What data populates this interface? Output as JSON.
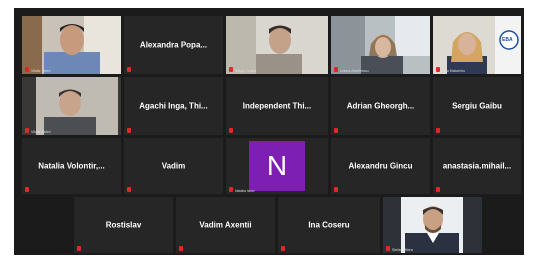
{
  "tiles": {
    "t1": {
      "caption": "Vitalie Tarlev"
    },
    "t2": {
      "name": "Alexandra Popa..."
    },
    "t3": {
      "caption": "Sergiu Dudka"
    },
    "t4": {
      "caption": "Iuliana Zamfirescu"
    },
    "t5": {
      "caption": "Irina Matcenko"
    },
    "t6": {
      "caption": "Vitalie Tarlev"
    },
    "t7": {
      "name": "Agachi Inga, Thi..."
    },
    "t8": {
      "name": "Independent Thi..."
    },
    "t9": {
      "name": "Adrian Gheorgh..."
    },
    "t10": {
      "name": "Sergiu Gaibu"
    },
    "t11": {
      "name": "Natalia Volontir,..."
    },
    "t12": {
      "name": "Vadim"
    },
    "t13": {
      "letter": "N",
      "caption": "Natalia Iarov"
    },
    "t14": {
      "name": "Alexandru Gincu"
    },
    "t15": {
      "name": "anastasia.mihail..."
    },
    "t16": {
      "name": "Rostislav"
    },
    "t17": {
      "name": "Vadim Axentii"
    },
    "t18": {
      "name": "Ina Coseru"
    },
    "t19": {
      "caption": "Stefan Mitrea"
    }
  },
  "eba_logo": "EBA"
}
